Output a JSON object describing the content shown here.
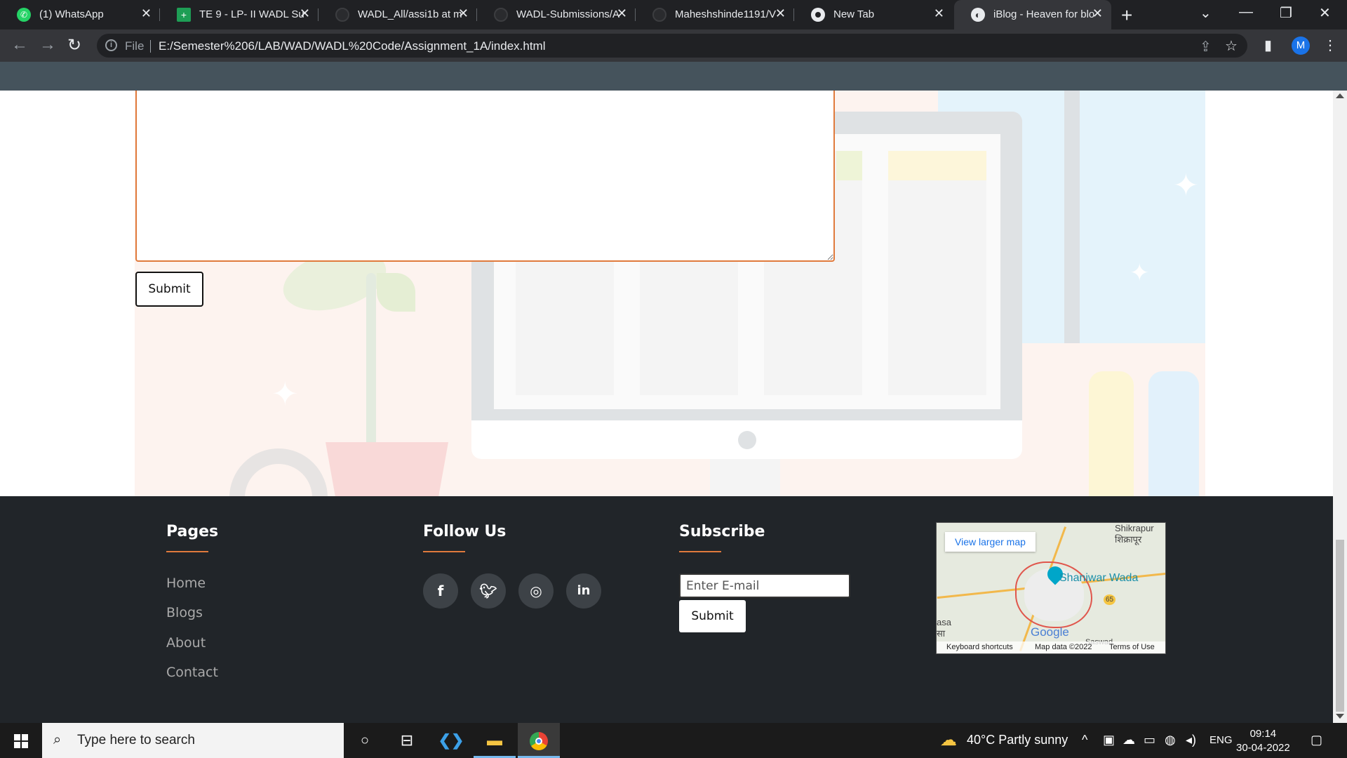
{
  "browser": {
    "tabs": [
      {
        "title": "(1) WhatsApp",
        "icon": "whatsapp-icon",
        "active": false
      },
      {
        "title": "TE 9 - LP- II WADL Sul",
        "icon": "sheets-icon",
        "active": false
      },
      {
        "title": "WADL_All/assi1b at m",
        "icon": "github-icon",
        "active": false
      },
      {
        "title": "WADL-Submissions/A",
        "icon": "github-icon",
        "active": false
      },
      {
        "title": "Maheshshinde1191/V",
        "icon": "github-icon",
        "active": false
      },
      {
        "title": "New Tab",
        "icon": "chrome-icon",
        "active": false
      },
      {
        "title": "iBlog - Heaven for blo",
        "icon": "globe-icon",
        "active": true
      }
    ],
    "new_tab": "+",
    "address": {
      "scheme_label": "File",
      "url": "E:/Semester%206/LAB/WAD/WADL%20Code/Assignment_1A/index.html"
    },
    "profile_initial": "M"
  },
  "page": {
    "form": {
      "submit_label": "Submit"
    },
    "footer": {
      "pages": {
        "heading": "Pages",
        "links": [
          "Home",
          "Blogs",
          "About",
          "Contact"
        ]
      },
      "follow": {
        "heading": "Follow Us",
        "icons": [
          "facebook-icon",
          "twitter-icon",
          "instagram-icon",
          "linkedin-icon"
        ]
      },
      "subscribe": {
        "heading": "Subscribe",
        "email_placeholder": "Enter E-mail",
        "submit_label": "Submit"
      },
      "map": {
        "view_larger": "View larger map",
        "place": "Shaniwar Wada",
        "town_en": "Shikrapur",
        "town_local": "शिक्रापूर",
        "road_number": "65",
        "left_label_en": "asa",
        "left_label_local": "सा",
        "bottom_label": "Saswad",
        "google": "Google",
        "keyboard": "Keyboard shortcuts",
        "mapdata": "Map data ©2022",
        "terms": "Terms of Use"
      }
    }
  },
  "taskbar": {
    "search_placeholder": "Type here to search",
    "weather": "40°C  Partly sunny",
    "language": "ENG",
    "time": "09:14",
    "date": "30-04-2022"
  }
}
